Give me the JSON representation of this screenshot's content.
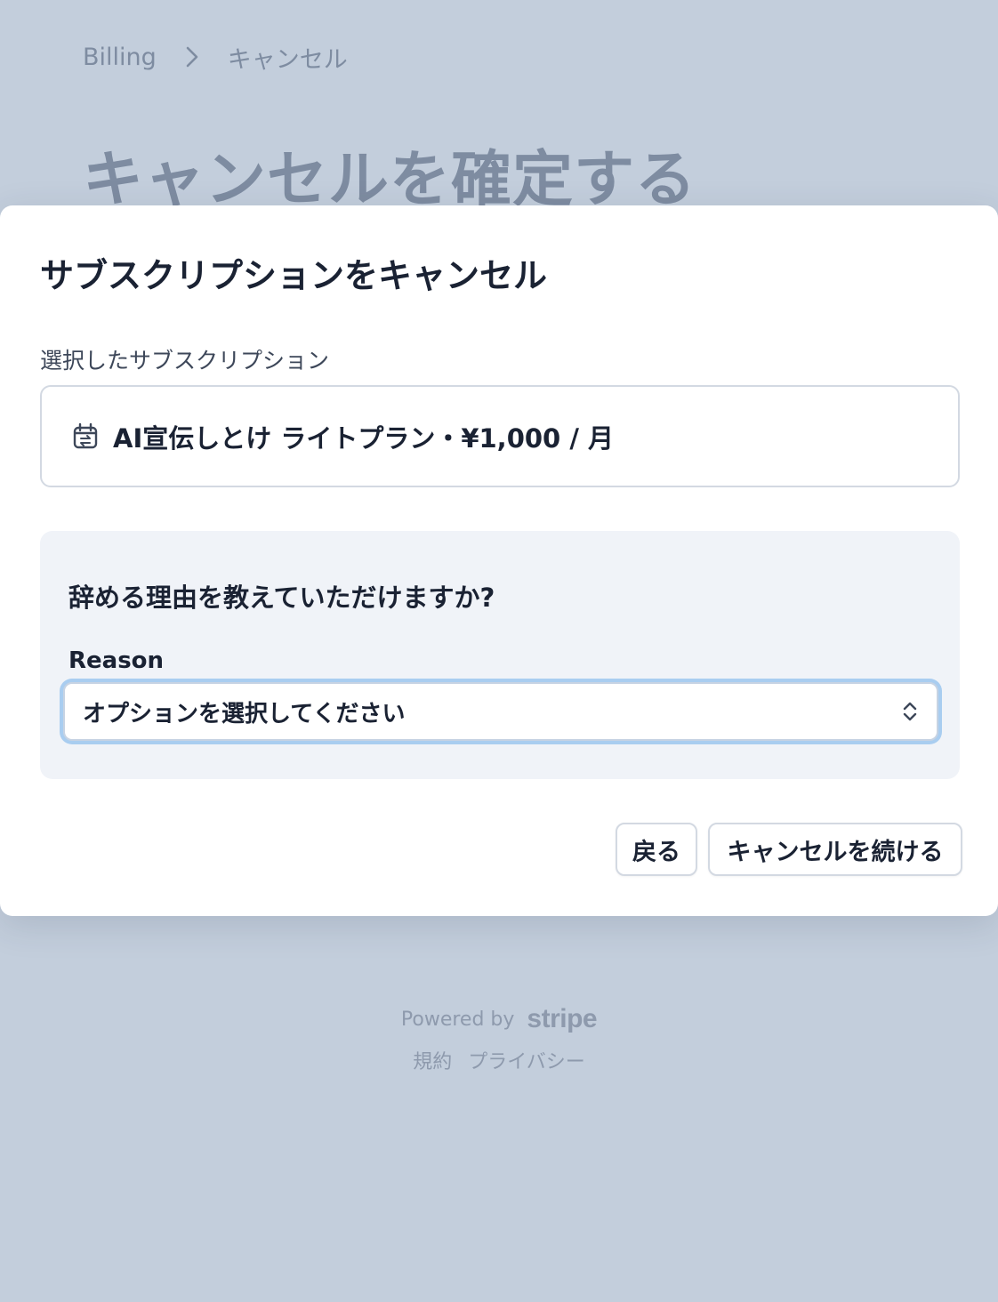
{
  "breadcrumb": {
    "root": "Billing",
    "current": "キャンセル"
  },
  "page": {
    "title": "キャンセルを確定する"
  },
  "modal": {
    "title": "サブスクリプションをキャンセル",
    "selected_label": "選択したサブスクリプション",
    "subscription_text": "AI宣伝しとけ ライトプラン・¥1,000 / 月",
    "subscription_icon": "calendar-repeat-icon",
    "reason_question": "辞める理由を教えていただけますか?",
    "reason_label": "Reason",
    "reason_placeholder": "オプションを選択してください",
    "back_label": "戻る",
    "continue_label": "キャンセルを続ける"
  },
  "footer": {
    "powered_by": "Powered by",
    "brand": "stripe",
    "terms": "規約",
    "privacy": "プライバシー"
  },
  "colors": {
    "backdrop": "#c3cedc",
    "panel": "#f0f3f8",
    "focus_ring": "#a9cdf0",
    "text": "#1a2233",
    "muted": "#7e8ca1"
  }
}
